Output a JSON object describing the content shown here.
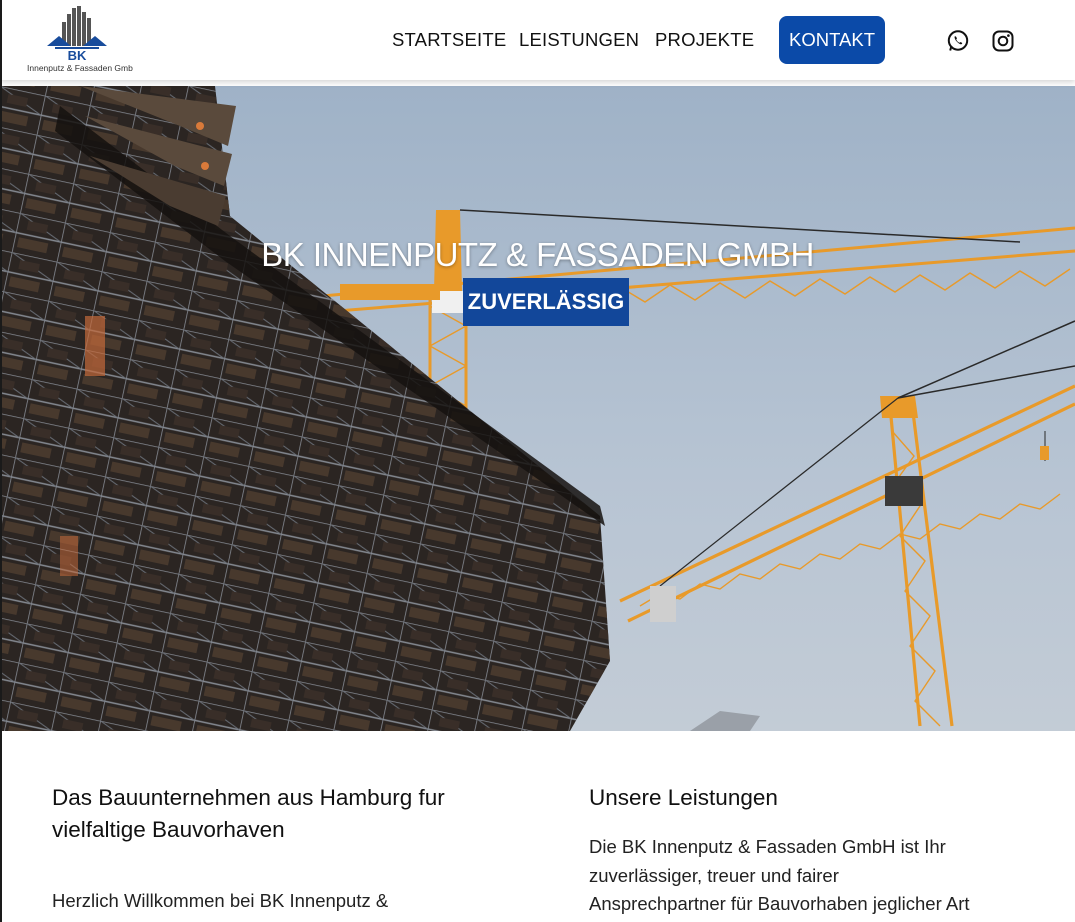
{
  "header": {
    "logo": {
      "initials": "BK",
      "tagline": "Innenputz & Fassaden Gmb"
    },
    "nav": [
      {
        "label": "STARTSEITE"
      },
      {
        "label": "LEISTUNGEN"
      },
      {
        "label": "PROJEKTE"
      }
    ],
    "cta_label": "KONTAKT",
    "social": [
      {
        "icon": "whatsapp-icon"
      },
      {
        "icon": "instagram-icon"
      }
    ]
  },
  "hero": {
    "title": "BK INNENPUTZ & FASSADEN GMBH",
    "badge": "ZUVERLÄSSIG"
  },
  "intro": {
    "heading_line1": "Das Bauunternehmen aus Hamburg fur",
    "heading_line2": "vielfaltige Bauvorhaven",
    "text": "Herzlich Willkommen bei BK Innenputz &"
  },
  "services": {
    "heading": "Unsere Leistungen",
    "text_line1": "Die BK Innenputz & Fassaden GmbH ist Ihr",
    "text_line2": "zuverlässiger, treuer und fairer",
    "text_line3": "Ansprechpartner für Bauvorhaben jeglicher Art"
  },
  "colors": {
    "brand": "#0b4aa8",
    "badge": "#12479a",
    "crane": "#e89a2a"
  }
}
